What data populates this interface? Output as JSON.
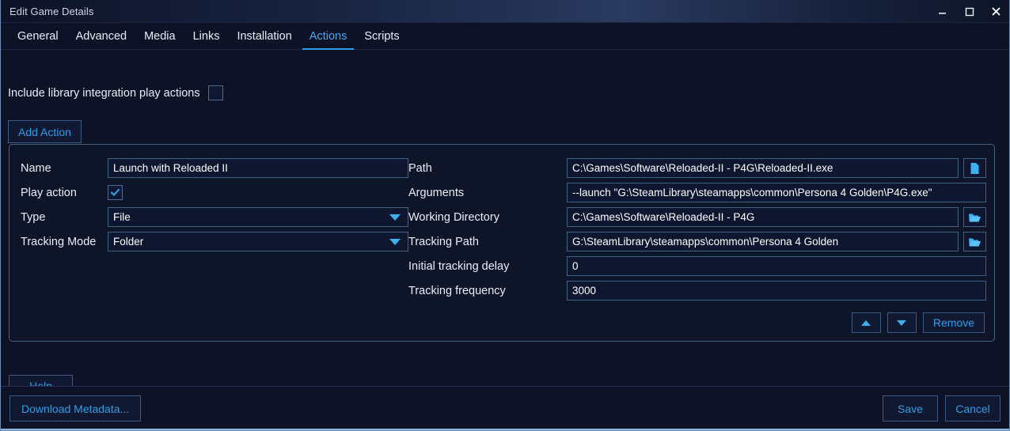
{
  "window": {
    "title": "Edit Game Details",
    "controls": [
      {
        "name": "minimize",
        "glyph": "minimize-icon"
      },
      {
        "name": "maximize",
        "glyph": "maximize-icon"
      },
      {
        "name": "close",
        "glyph": "close-icon"
      }
    ]
  },
  "tabs": [
    {
      "label": "General",
      "active": false
    },
    {
      "label": "Advanced",
      "active": false
    },
    {
      "label": "Media",
      "active": false
    },
    {
      "label": "Links",
      "active": false
    },
    {
      "label": "Installation",
      "active": false
    },
    {
      "label": "Actions",
      "active": true
    },
    {
      "label": "Scripts",
      "active": false
    }
  ],
  "options": {
    "include_library_label": "Include library integration play actions",
    "include_library_checked": false
  },
  "toolbar": {
    "add_action_label": "Add Action"
  },
  "action": {
    "labels": {
      "name": "Name",
      "play_action": "Play action",
      "type": "Type",
      "tracking_mode": "Tracking Mode",
      "path": "Path",
      "arguments": "Arguments",
      "working_directory": "Working Directory",
      "tracking_path": "Tracking Path",
      "initial_tracking_delay": "Initial tracking delay",
      "tracking_frequency": "Tracking frequency"
    },
    "values": {
      "name": "Launch with Reloaded II",
      "play_action_checked": true,
      "type": "File",
      "tracking_mode": "Folder",
      "path": "C:\\Games\\Software\\Reloaded-II - P4G\\Reloaded-II.exe",
      "arguments": "--launch \"G:\\SteamLibrary\\steamapps\\common\\Persona 4 Golden\\P4G.exe\"",
      "working_directory": "C:\\Games\\Software\\Reloaded-II - P4G",
      "tracking_path": "G:\\SteamLibrary\\steamapps\\common\\Persona 4 Golden",
      "initial_tracking_delay": "0",
      "tracking_frequency": "3000"
    },
    "buttons": {
      "move_up": "move-up-icon",
      "move_down": "move-down-icon",
      "remove": "Remove"
    }
  },
  "footer": {
    "help": "Help",
    "download_metadata": "Download Metadata...",
    "save": "Save",
    "cancel": "Cancel"
  },
  "colors": {
    "accent": "#2f9ee8",
    "background": "#0d1226",
    "panel": "#0e1529",
    "border": "#3f6383",
    "text": "#e9eef7"
  }
}
